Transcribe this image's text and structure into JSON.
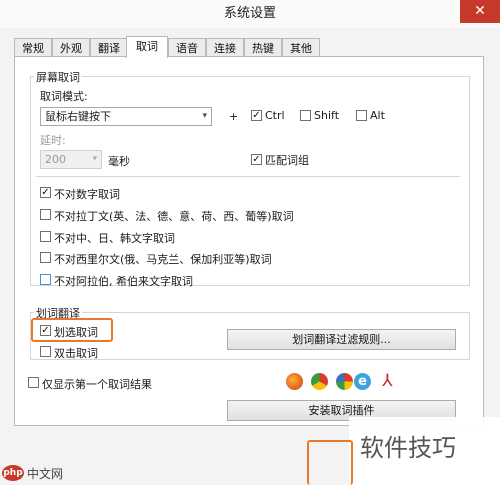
{
  "window": {
    "title": "系统设置",
    "close_glyph": "✕"
  },
  "tabs": [
    {
      "label": "常规"
    },
    {
      "label": "外观"
    },
    {
      "label": "翻译"
    },
    {
      "label": "取词"
    },
    {
      "label": "语音"
    },
    {
      "label": "连接"
    },
    {
      "label": "热键"
    },
    {
      "label": "其他"
    }
  ],
  "active_tab": "取词",
  "screen_group": {
    "title": "屏幕取词",
    "mode_label": "取词模式:",
    "mode_value": "鼠标右键按下",
    "plus": "+",
    "ctrl": {
      "label": "Ctrl",
      "checked": true
    },
    "shift": {
      "label": "Shift",
      "checked": false
    },
    "alt": {
      "label": "Alt",
      "checked": false
    },
    "delay_label": "延时:",
    "delay_value": "200",
    "delay_unit": "毫秒",
    "match_phrase": {
      "label": "匹配词组",
      "checked": true
    }
  },
  "exclusions": [
    {
      "label": "不对数字取词",
      "checked": true
    },
    {
      "label": "不对拉丁文(英、法、德、意、荷、西、葡等)取词",
      "checked": false
    },
    {
      "label": "不对中、日、韩文字取词",
      "checked": false
    },
    {
      "label": "不对西里尔文(俄、马克兰、保加利亚等)取词",
      "checked": false
    },
    {
      "label": "不对阿拉伯, 希伯来文字取词",
      "checked": false
    }
  ],
  "select_translate": {
    "title": "划词翻译",
    "select_word": {
      "label": "划选取词",
      "checked": true
    },
    "double_click": {
      "label": "双击取词",
      "checked": false
    },
    "filter_button": "划词翻译过滤规则..."
  },
  "first_only": {
    "label": "仅显示第一个取词结果",
    "checked": false
  },
  "browser_icons": [
    {
      "name": "firefox-icon",
      "color": "#e8661f"
    },
    {
      "name": "chrome-icon",
      "color": "#d63c2f"
    },
    {
      "name": "opera-icon",
      "color": "#3a6fc4"
    },
    {
      "name": "ie-icon",
      "color": "#3aa4e0"
    },
    {
      "name": "pdf-icon",
      "color": "#c2281c"
    }
  ],
  "install_button": "安装取词插件",
  "watermark": {
    "logo": "php",
    "site": "中文网",
    "right_text": "软件技巧"
  },
  "colors": {
    "highlight": "#e8792a",
    "close": "#c7392b"
  }
}
